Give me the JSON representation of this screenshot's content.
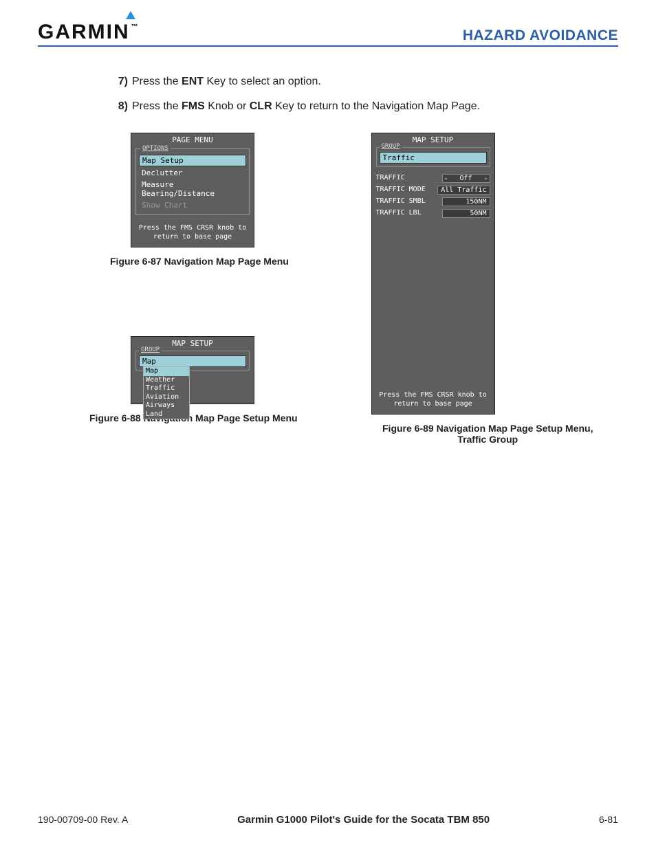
{
  "header": {
    "brand": "GARMIN",
    "section_title": "HAZARD AVOIDANCE"
  },
  "steps": [
    {
      "num": "7)",
      "pre": "Press the ",
      "key1": "ENT",
      "post": " Key to select an option."
    },
    {
      "num": "8)",
      "pre": "Press the ",
      "key1": "FMS",
      "mid": " Knob or ",
      "key2": "CLR",
      "post": " Key to return to the Navigation Map Page."
    }
  ],
  "figure87": {
    "title": "PAGE MENU",
    "group_legend": "OPTIONS",
    "items": [
      "Map Setup",
      "Declutter",
      "Measure Bearing/Distance",
      "Show Chart"
    ],
    "hint1": "Press the FMS CRSR knob to",
    "hint2": "return to base page",
    "caption": "Figure 6-87  Navigation Map Page Menu"
  },
  "figure88": {
    "title": "MAP SETUP",
    "group_legend": "GROUP",
    "field_value": "Map",
    "dropdown": [
      "Map",
      "Weather",
      "Traffic",
      "Aviation",
      "Airways",
      "Land"
    ],
    "caption": "Figure 6-88  Navigation Map Page Setup Menu"
  },
  "figure89": {
    "title": "MAP SETUP",
    "group_legend": "GROUP",
    "field_value": "Traffic",
    "rows": [
      {
        "label": "TRAFFIC",
        "value": "Off",
        "sel": true
      },
      {
        "label": "TRAFFIC MODE",
        "value": "All Traffic"
      },
      {
        "label": "TRAFFIC SMBL",
        "value": "150NM",
        "right": true
      },
      {
        "label": "TRAFFIC LBL",
        "value": "50NM",
        "right": true
      }
    ],
    "hint1": "Press the FMS CRSR knob to",
    "hint2": "return to base page",
    "caption": "Figure 6-89  Navigation Map Page Setup Menu, Traffic Group"
  },
  "footer": {
    "left": "190-00709-00  Rev. A",
    "center": "Garmin G1000 Pilot's Guide for the Socata TBM 850",
    "right": "6-81"
  }
}
